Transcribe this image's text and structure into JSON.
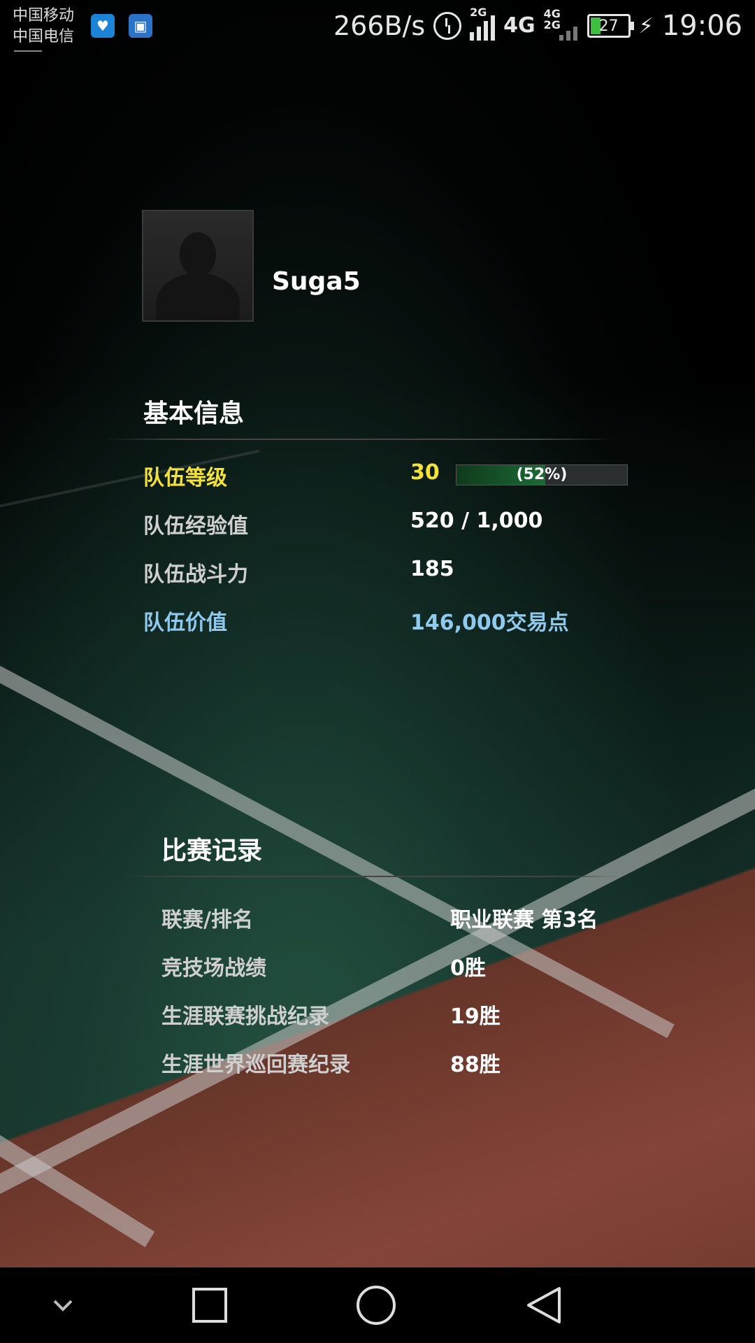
{
  "status_bar": {
    "carrier_1": "中国移动",
    "carrier_2": "中国电信",
    "net_speed": "266B/s",
    "signal_1_label": "2G",
    "network_4g": "4G",
    "signal_2_label": "4G\n2G",
    "battery": "27",
    "time": "19:06"
  },
  "profile": {
    "username": "Suga5"
  },
  "basic_info": {
    "title": "基本信息",
    "rows": [
      {
        "label": "队伍等级",
        "value": "30"
      },
      {
        "label": "队伍经验值",
        "value": "520 / 1,000"
      },
      {
        "label": "队伍战斗力",
        "value": "185"
      },
      {
        "label": "队伍价值",
        "value": "146,000交易点"
      }
    ],
    "level_progress": {
      "percent": 52,
      "text": "(52%)"
    }
  },
  "match_record": {
    "title": "比赛记录",
    "rows": [
      {
        "label": "联赛/排名",
        "value": "职业联赛 第3名"
      },
      {
        "label": "竞技场战绩",
        "value": "0胜"
      },
      {
        "label": "生涯联赛挑战纪录",
        "value": "19胜"
      },
      {
        "label": "生涯世界巡回赛纪录",
        "value": "88胜"
      }
    ]
  },
  "colors": {
    "level_highlight": "#f4e23a",
    "value_highlight": "#8fc9ee",
    "progress_fill": "#1b6b34"
  },
  "icons": {
    "nav_down": "chevron-down-icon",
    "nav_recent": "square-icon",
    "nav_home": "circle-icon",
    "nav_back": "triangle-back-icon"
  }
}
